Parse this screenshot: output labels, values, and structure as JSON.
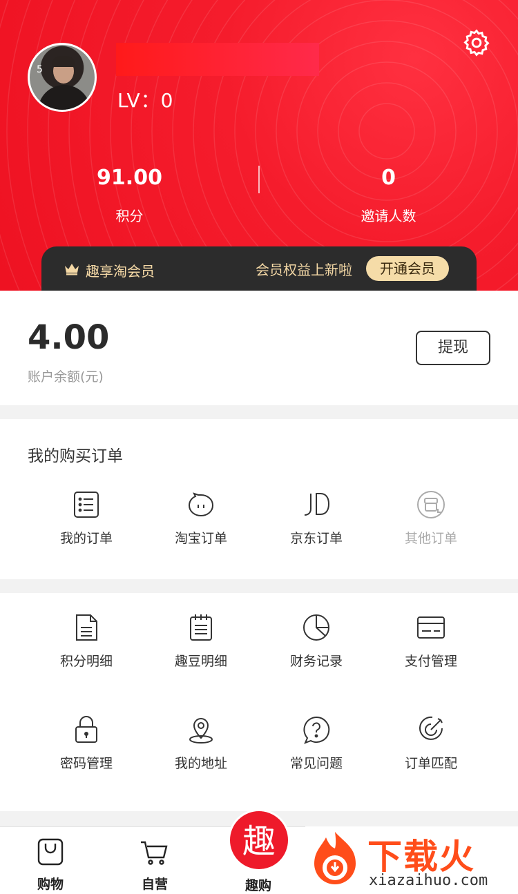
{
  "header": {
    "level": "LV：0",
    "stats": [
      {
        "value": "91.00",
        "label": "积分"
      },
      {
        "value": "0",
        "label": "邀请人数"
      }
    ],
    "avatar_badge": "5"
  },
  "vip": {
    "title": "趣享淘会员",
    "news": "会员权益上新啦",
    "open_button": "开通会员"
  },
  "balance": {
    "amount": "4.00",
    "label": "账户余额(元)",
    "withdraw_button": "提现"
  },
  "orders": {
    "title": "我的购买订单",
    "items": [
      {
        "label": "我的订单",
        "icon": "order-list-icon"
      },
      {
        "label": "淘宝订单",
        "icon": "taobao-icon"
      },
      {
        "label": "京东订单",
        "icon": "jd-icon"
      },
      {
        "label": "其他订单",
        "icon": "other-orders-icon"
      }
    ]
  },
  "tools": {
    "items": [
      {
        "label": "积分明细",
        "icon": "document-icon"
      },
      {
        "label": "趣豆明细",
        "icon": "notepad-icon"
      },
      {
        "label": "财务记录",
        "icon": "pie-chart-icon"
      },
      {
        "label": "支付管理",
        "icon": "card-icon"
      },
      {
        "label": "密码管理",
        "icon": "lock-icon"
      },
      {
        "label": "我的地址",
        "icon": "location-icon"
      },
      {
        "label": "常见问题",
        "icon": "help-icon"
      },
      {
        "label": "订单匹配",
        "icon": "target-icon"
      }
    ]
  },
  "tabbar": {
    "tabs": [
      {
        "label": "购物",
        "icon": "shopping-bag-icon"
      },
      {
        "label": "自营",
        "icon": "cart-icon"
      },
      {
        "label": "趣购",
        "icon": "qu-icon",
        "glyph": "趣"
      }
    ]
  },
  "watermark": {
    "text": "下载火",
    "domain": "xiazaihuo.com"
  },
  "colors": {
    "brand_red": "#ee1a2a",
    "vip_gold": "#f5dca8",
    "vip_dark": "#2c2c2c"
  }
}
